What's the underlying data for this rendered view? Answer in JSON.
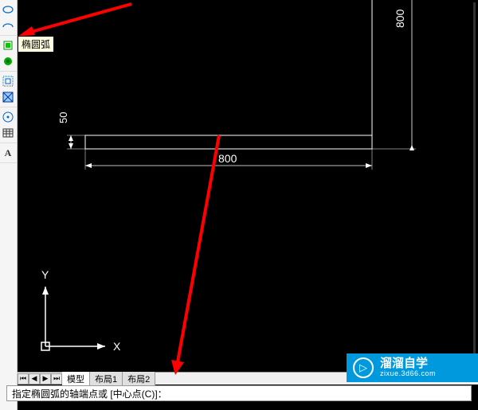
{
  "toolbar": {
    "tools": [
      "ellipse",
      "ellipse-arc",
      "block",
      "hatch",
      "region",
      "group",
      "table",
      "field",
      "text"
    ]
  },
  "tooltip": "椭圆弧",
  "chart_data": {
    "type": "diagram",
    "elements": [
      {
        "shape": "rectangle",
        "width_label": "800",
        "height_label": "50"
      },
      {
        "shape": "vertical-line",
        "dimension_label": "800"
      }
    ],
    "dimensions": {
      "horizontal": 800,
      "rect_height": 50,
      "vertical_line": 800
    }
  },
  "drawing": {
    "dim_horizontal": "800",
    "dim_rect_height": "50",
    "dim_vertical": "800",
    "axis_x": "X",
    "axis_y": "Y"
  },
  "tabs": {
    "model": "模型",
    "layout1": "布局1",
    "layout2": "布局2"
  },
  "command": {
    "prompt": "指定椭圆弧的轴端点或 [中心点(C)]："
  },
  "watermark": {
    "main": "溜溜自学",
    "sub": "zixue.3d66.com",
    "logo": "▷"
  }
}
